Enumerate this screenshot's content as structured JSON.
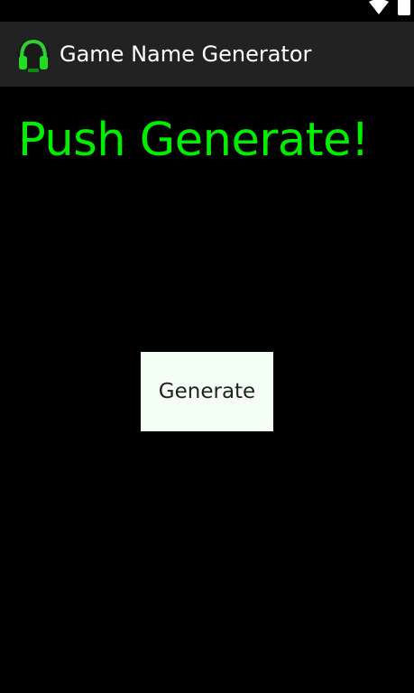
{
  "app": {
    "title": "Game Name Generator",
    "icon": "headphones-icon"
  },
  "status_bar": {
    "icons": [
      "wifi-icon",
      "battery-icon"
    ]
  },
  "main": {
    "headline": "Push Generate!",
    "generate_button_label": "Generate"
  },
  "colors": {
    "background": "#000000",
    "action_bar": "#222222",
    "headline": "#00ee00",
    "button_background": "#f2fff2",
    "button_text": "#222222"
  }
}
